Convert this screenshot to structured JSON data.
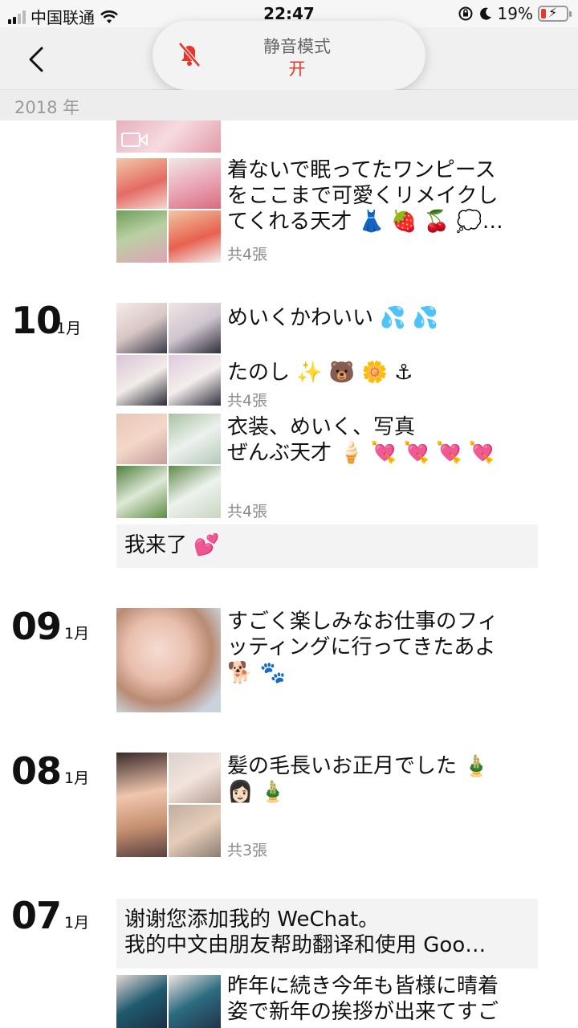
{
  "status_bar": {
    "carrier": "中国联通",
    "time": "22:47",
    "battery": "19%",
    "battery_level": 0.19
  },
  "toast": {
    "title": "静音模式",
    "value": "开"
  },
  "year_header": "2018 年",
  "posts": {
    "p0": {
      "text": "着ないで眠ってたワンピース\nをここまで可愛くリメイクし\nてくれる天才 👗 🍓 🍒 💭…",
      "count": "共4張"
    },
    "d10": {
      "day": "10",
      "month": "1月"
    },
    "p1": {
      "text": "めいくかわいい 💦 💦",
      "count": ""
    },
    "p2": {
      "text": "たのし ✨ 🐻 🌼 ⚓",
      "count": "共4張"
    },
    "p3": {
      "text": "衣装、めいく、写真\nぜんぶ天才 🍦 💘 💘 💘 💘",
      "count": "共4張"
    },
    "p4": {
      "text": "我来了 💕"
    },
    "d09": {
      "day": "09",
      "month": "1月"
    },
    "p5": {
      "text": "すごく楽しみなお仕事のフィ\nッティングに行ってきたあよ\n🐕 🐾"
    },
    "d08": {
      "day": "08",
      "month": "1月"
    },
    "p6": {
      "text": "髪の毛長いお正月でした 🎍\n👩🏻 🎍",
      "count": "共3張"
    },
    "d07": {
      "day": "07",
      "month": "1月"
    },
    "p7": {
      "text": "谢谢您添加我的 WeChat。\n我的中文由朋友帮助翻译和使用 Goo…"
    },
    "p8": {
      "text": "昨年に続き今年も皆様に晴着\n姿で新年の挨拶が出来てすご"
    }
  }
}
